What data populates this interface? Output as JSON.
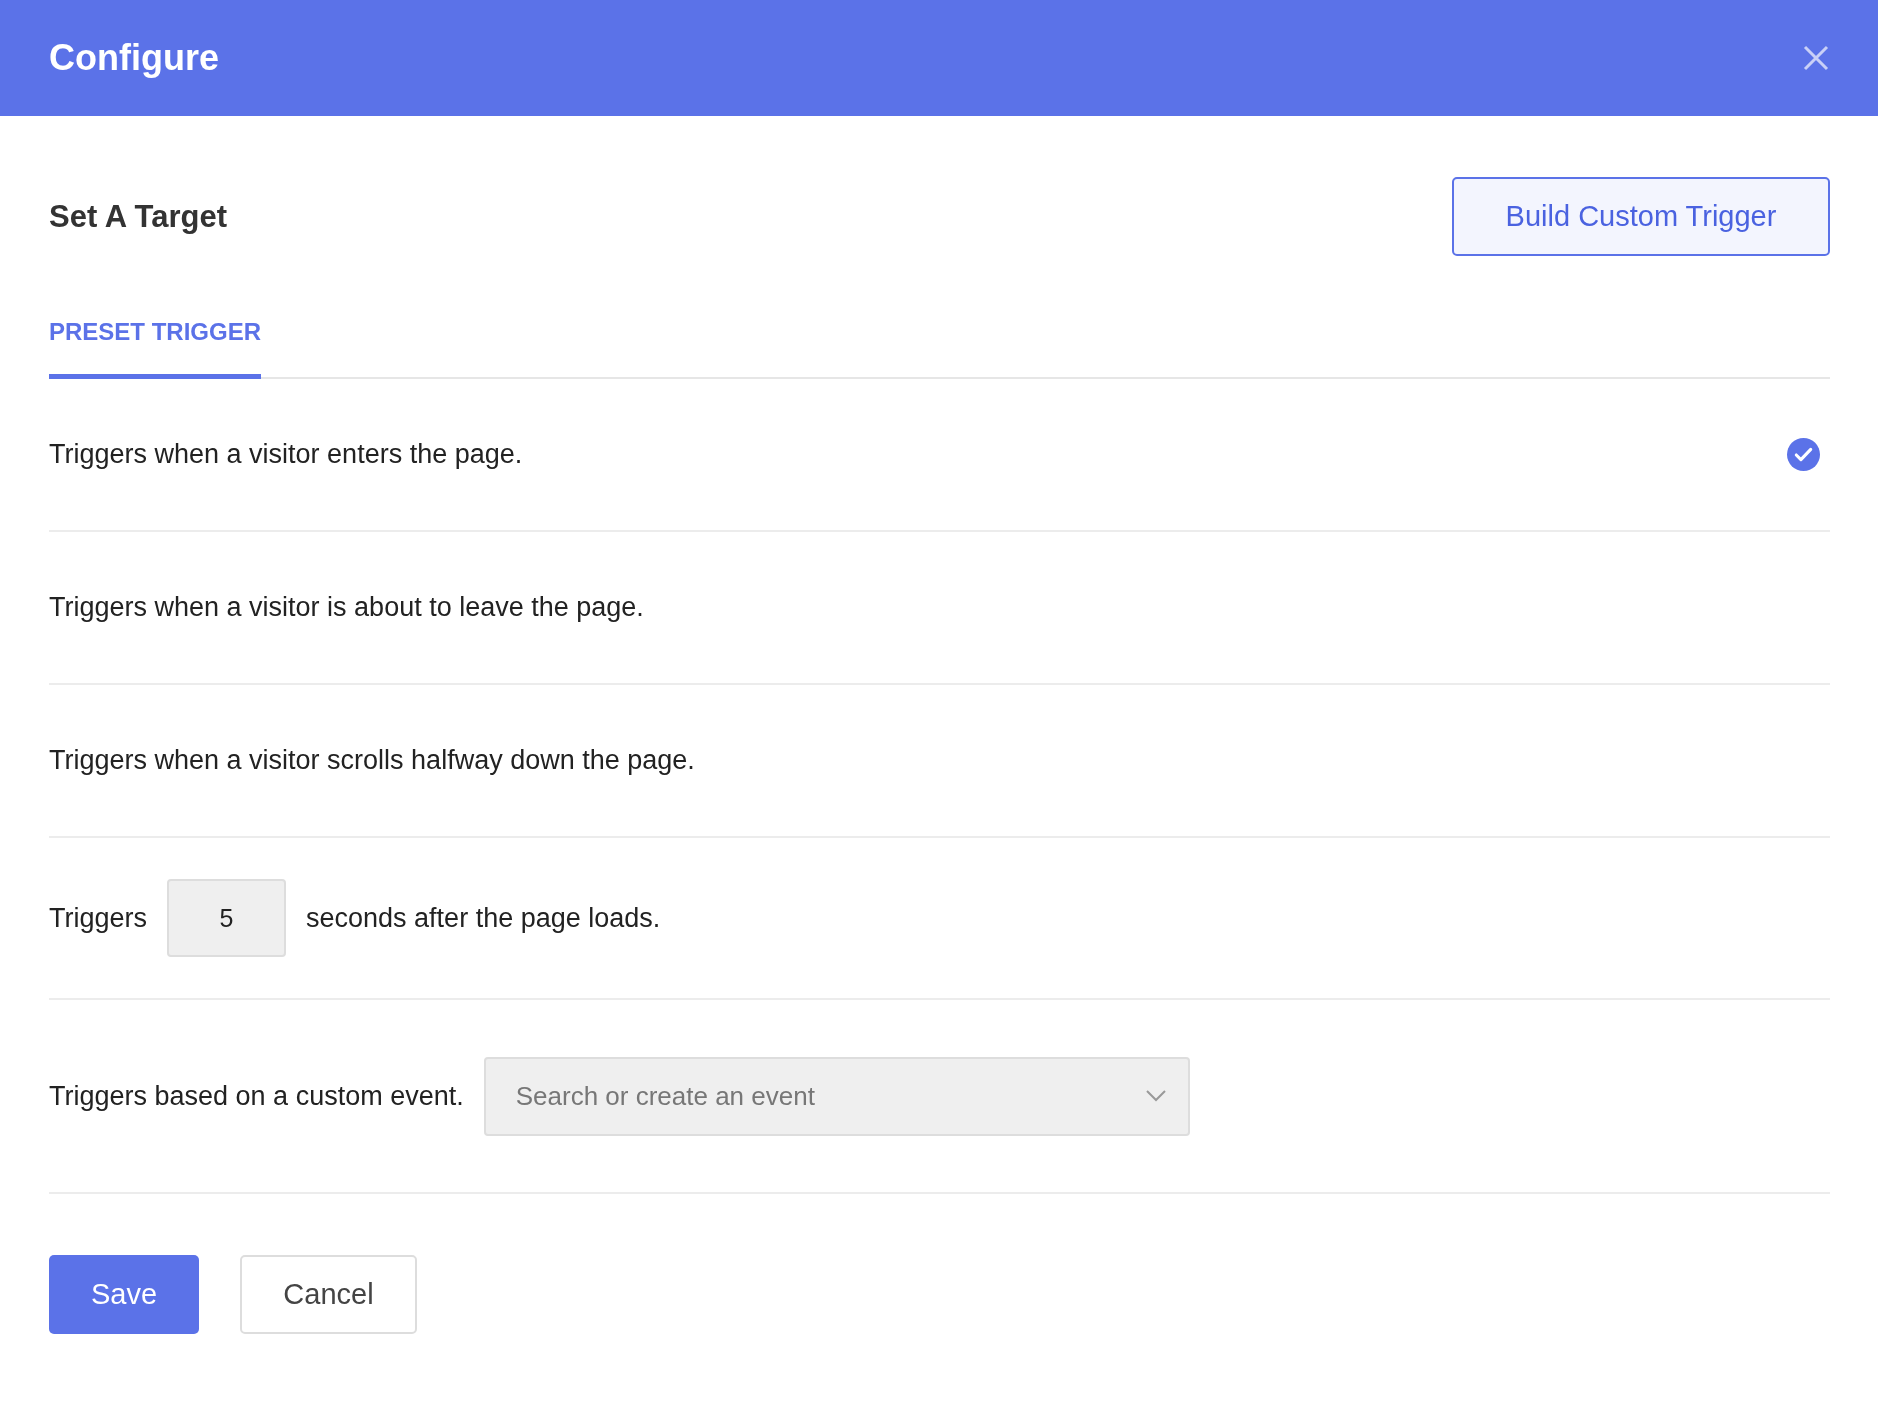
{
  "dialog": {
    "title": "Configure"
  },
  "section": {
    "title": "Set A Target",
    "custom_button": "Build Custom Trigger"
  },
  "tabs": [
    {
      "label": "PRESET TRIGGER",
      "selected": true
    }
  ],
  "triggers": [
    {
      "kind": "text",
      "text": "Triggers when a visitor enters the page.",
      "selected": true
    },
    {
      "kind": "text",
      "text": "Triggers when a visitor is about to leave the page.",
      "selected": false
    },
    {
      "kind": "text",
      "text": "Triggers when a visitor scrolls halfway down the page.",
      "selected": false
    },
    {
      "kind": "delay",
      "before": "Triggers",
      "value": "5",
      "after": "seconds after the page loads.",
      "selected": false
    },
    {
      "kind": "event",
      "text": "Triggers based on a custom event.",
      "placeholder": "Search or create an event",
      "selected": false
    }
  ],
  "buttons": [
    {
      "kind": "primary",
      "label": "Save"
    },
    {
      "kind": "secondary",
      "label": "Cancel"
    }
  ]
}
